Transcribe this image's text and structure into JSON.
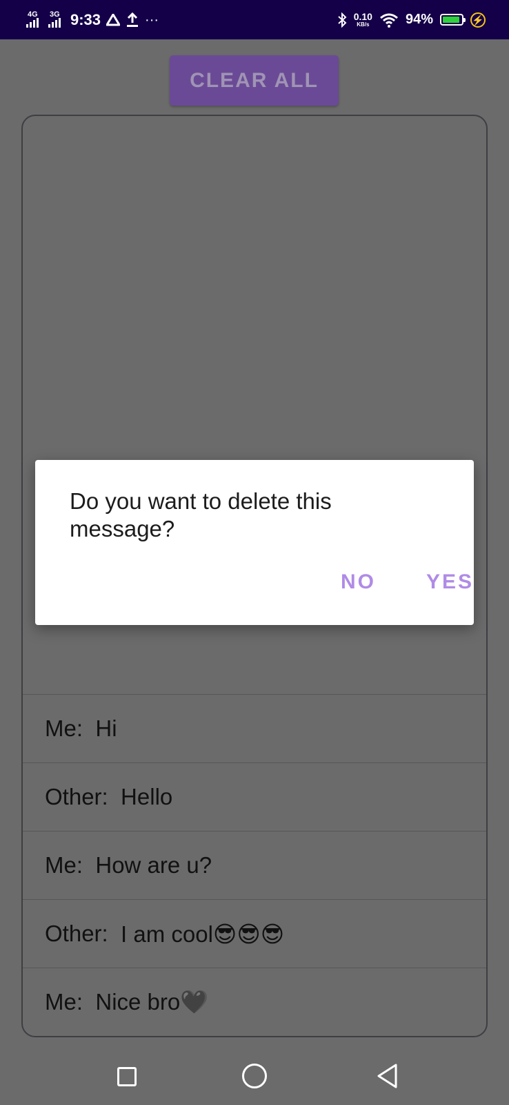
{
  "status_bar": {
    "network_1": "4G",
    "network_2": "3G",
    "time": "9:33",
    "extra_icons": [
      "drive-icon",
      "upload-icon",
      "more-icon"
    ],
    "overflow": "···",
    "speed_value": "0.10",
    "speed_unit": "KB/s",
    "battery_percent": "94%",
    "battery_level": 0.94,
    "battery_color": "#2fd13d",
    "charging_color": "#f5c518",
    "background_color": "#140048"
  },
  "toolbar": {
    "clear_all_label": "CLEAR ALL",
    "button_color": "#6a4a96"
  },
  "messages": [
    {
      "sender": "Me:",
      "text": "Hi"
    },
    {
      "sender": "Other:",
      "text": "Hello"
    },
    {
      "sender": "Me:",
      "text": "How are u?"
    },
    {
      "sender": "Other:",
      "text": "I am cool😎😎😎"
    },
    {
      "sender": "Me:",
      "text": "Nice bro🖤"
    }
  ],
  "dialog": {
    "message": "Do you want to delete this message?",
    "no_label": "NO",
    "yes_label": "YES",
    "accent_color": "#b08be6"
  },
  "nav_bar": {
    "icons": [
      "recent-apps-icon",
      "home-icon",
      "back-icon"
    ]
  }
}
